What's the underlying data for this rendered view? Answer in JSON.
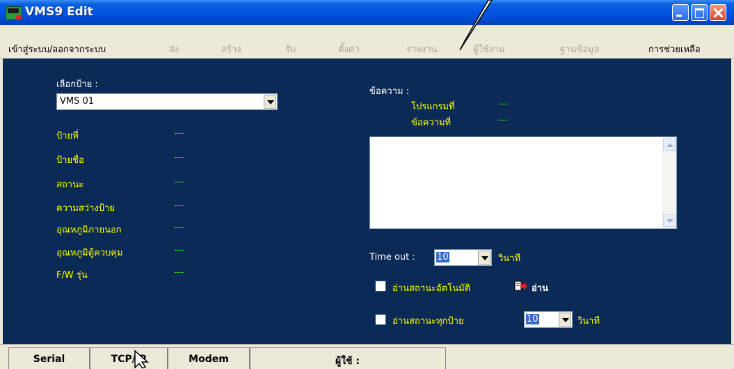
{
  "window": {
    "title": "VMS9 Edit"
  },
  "menu": [
    {
      "label": "เข้าสู่ระบบ/ออกจากระบบ",
      "enabled": true
    },
    {
      "label": "ส่ง",
      "enabled": false
    },
    {
      "label": "สร้าง",
      "enabled": false
    },
    {
      "label": "รับ",
      "enabled": false
    },
    {
      "label": "ตั้งค่า",
      "enabled": false
    },
    {
      "label": "รายงาน",
      "enabled": false
    },
    {
      "label": "ผู้ใช้งาน",
      "enabled": false
    },
    {
      "label": "ฐานข้อมูล",
      "enabled": false
    },
    {
      "label": "การช่วยเหลือ",
      "enabled": true
    }
  ],
  "left": {
    "select_label": "เลือกป้าย :",
    "select_value": "VMS 01",
    "fields": [
      {
        "label": "ป้ายที่",
        "value": "---"
      },
      {
        "label": "ป้ายชื่อ",
        "value": "---"
      },
      {
        "label": "สถานะ",
        "value": "---"
      },
      {
        "label": "ความสว่างป้าย",
        "value": "---"
      },
      {
        "label": "อุณหภูมิภายนอก",
        "value": "---"
      },
      {
        "label": "อุณหภูมิตู้ควบคุม",
        "value": "---"
      },
      {
        "label": "F/W รุ่น",
        "value": "---"
      }
    ]
  },
  "right": {
    "message_label": "ข้อความ :",
    "program_label": "โปรแกรมที่",
    "program_value": "---",
    "message_no_label": "ข้อความที่",
    "message_no_value": "---",
    "timeout_label": "Time out :",
    "timeout_value": "10",
    "timeout_unit": "วินาที",
    "auto_read_label": "อ่านสถานะอัตโนมัติ",
    "read_button": "อ่าน",
    "read_all_label": "อ่านสถานะทุกป้าย",
    "read_all_value": "10",
    "read_all_unit": "วินาที"
  },
  "status": {
    "tabs": [
      "Serial",
      "TCP/IP",
      "Modem"
    ],
    "user_label": "ผู้ใช้ :"
  },
  "colors": {
    "panel": "#0b2a55",
    "label": "#ffff00",
    "value": "#2ee82e"
  }
}
